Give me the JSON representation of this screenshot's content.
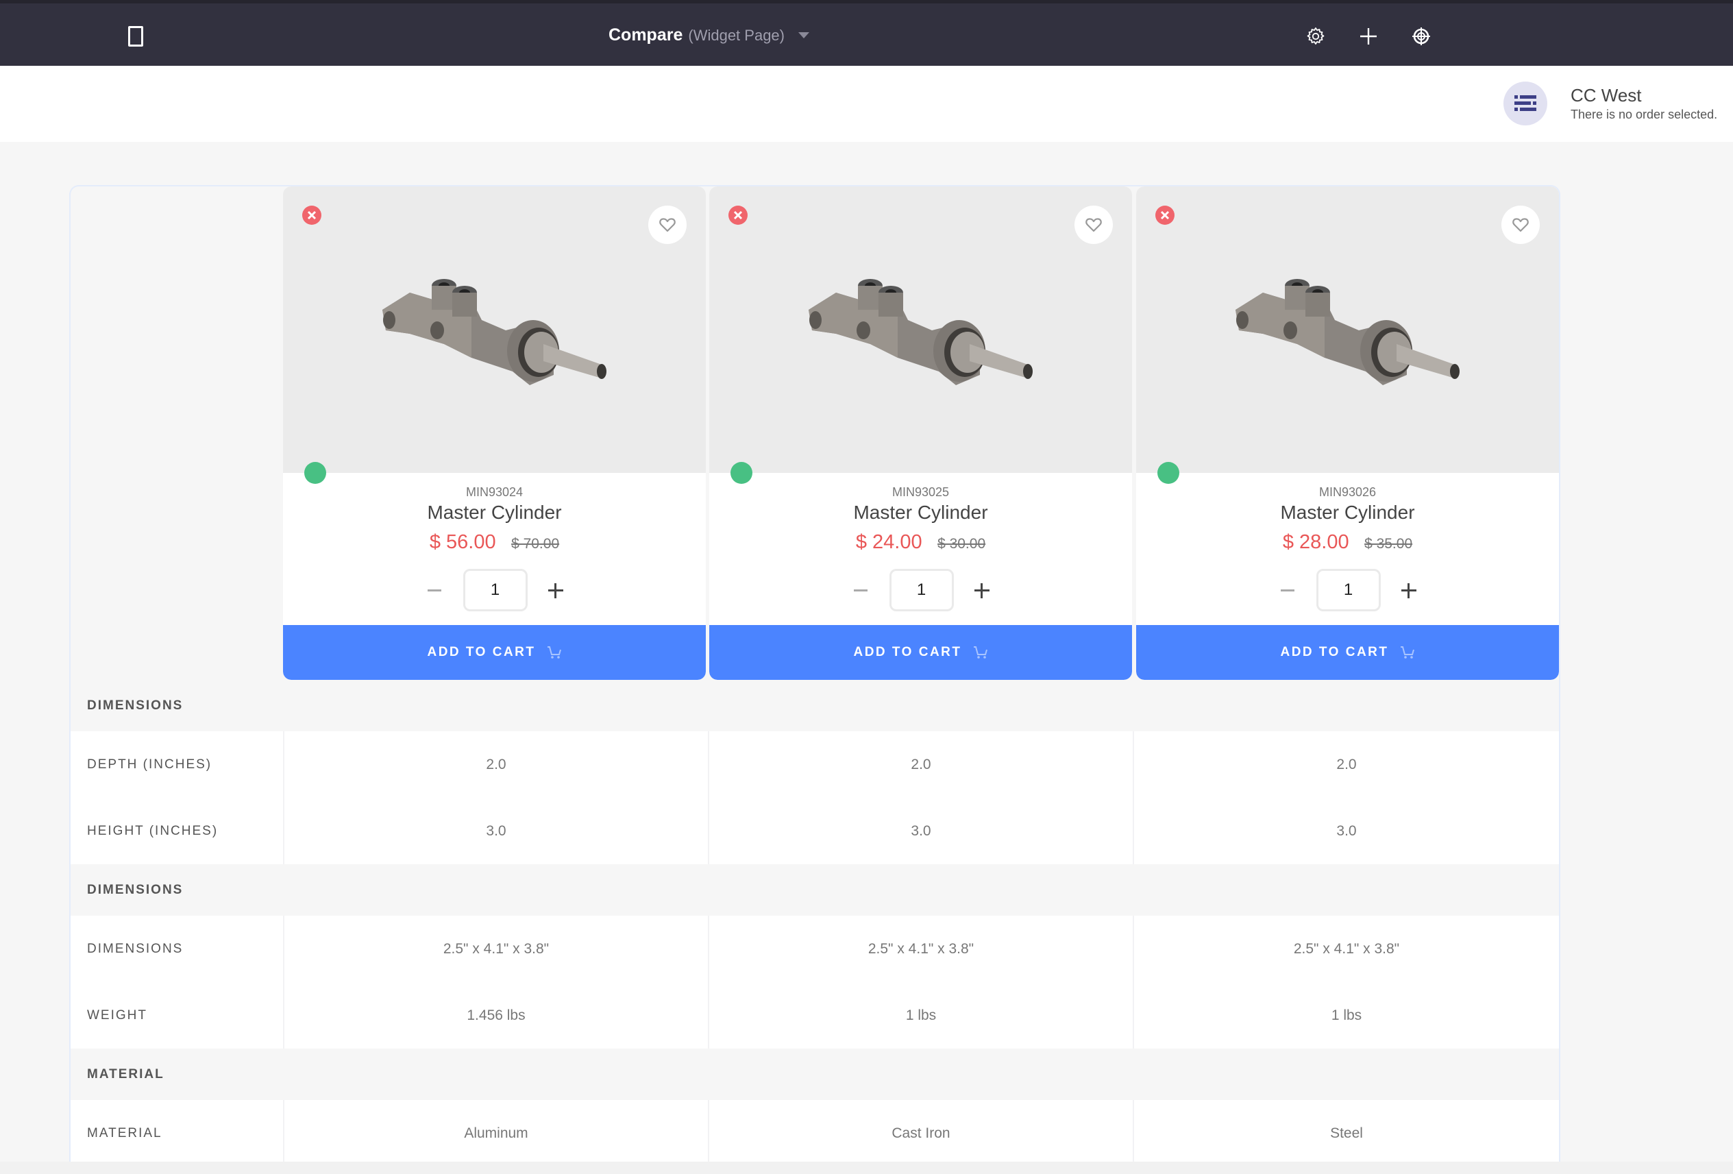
{
  "topbar": {
    "page_icon": "page-icon",
    "title": "Compare",
    "subtitle": "(Widget Page)",
    "dropdown_icon": "caret-down-icon",
    "actions": [
      {
        "name": "settings",
        "icon": "gear-icon"
      },
      {
        "name": "add",
        "icon": "plus-icon"
      },
      {
        "name": "simulation",
        "icon": "target-icon"
      }
    ]
  },
  "account": {
    "icon": "order-list-icon",
    "name": "CC West",
    "order_status": "There is no order selected."
  },
  "colors": {
    "topbar_bg": "#32313f",
    "accent": "#4b84ff",
    "sale_price": "#e95757",
    "remove": "#f0656c",
    "in_stock": "#48c083"
  },
  "products": [
    {
      "sku": "MIN93024",
      "name": "Master Cylinder",
      "price": "$ 56.00",
      "list_price": "$ 70.00",
      "quantity": "1",
      "add_to_cart": "ADD TO CART",
      "availability": "in-stock"
    },
    {
      "sku": "MIN93025",
      "name": "Master Cylinder",
      "price": "$ 24.00",
      "list_price": "$ 30.00",
      "quantity": "1",
      "add_to_cart": "ADD TO CART",
      "availability": "in-stock"
    },
    {
      "sku": "MIN93026",
      "name": "Master Cylinder",
      "price": "$ 28.00",
      "list_price": "$ 35.00",
      "quantity": "1",
      "add_to_cart": "ADD TO CART",
      "availability": "in-stock"
    }
  ],
  "spec_sections": [
    {
      "title": "DIMENSIONS",
      "rows": [
        {
          "label": "DEPTH (INCHES)",
          "values": [
            "2.0",
            "2.0",
            "2.0"
          ]
        },
        {
          "label": "HEIGHT (INCHES)",
          "values": [
            "3.0",
            "3.0",
            "3.0"
          ]
        }
      ]
    },
    {
      "title": "DIMENSIONS",
      "rows": [
        {
          "label": "DIMENSIONS",
          "values": [
            "2.5\" x 4.1\" x 3.8\"",
            "2.5\" x 4.1\" x 3.8\"",
            "2.5\" x 4.1\" x 3.8\""
          ]
        },
        {
          "label": "WEIGHT",
          "values": [
            "1.456 lbs",
            "1 lbs",
            "1 lbs"
          ]
        }
      ]
    },
    {
      "title": "MATERIAL",
      "rows": [
        {
          "label": "MATERIAL",
          "values": [
            "Aluminum",
            "Cast Iron",
            "Steel"
          ]
        }
      ]
    }
  ]
}
